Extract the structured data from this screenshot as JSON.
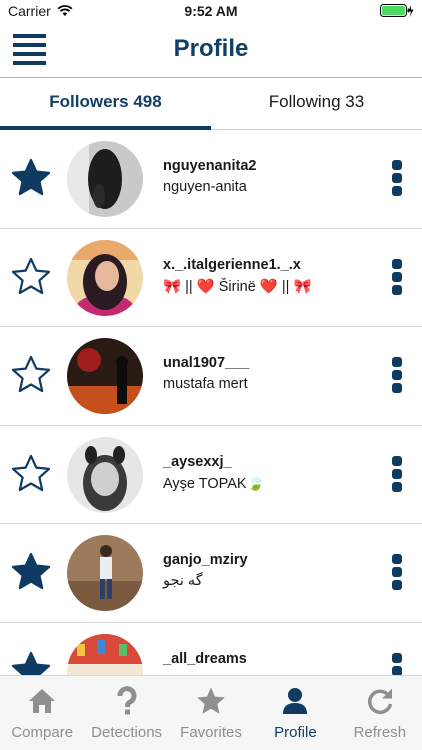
{
  "status_bar": {
    "carrier": "Carrier",
    "time": "9:52 AM"
  },
  "header": {
    "title": "Profile"
  },
  "tabs": [
    {
      "label": "Followers 498",
      "active": true
    },
    {
      "label": "Following 33",
      "active": false
    }
  ],
  "followers": [
    {
      "username": "nguyenanita2",
      "fullname": "nguyen-anita",
      "favorite": true
    },
    {
      "username": "x._.italgerienne1._.x",
      "fullname": "🎀 || ❤️ Širinë ❤️ || 🎀",
      "favorite": false
    },
    {
      "username": "unal1907___",
      "fullname": "mustafa mert",
      "favorite": false
    },
    {
      "username": "_aysexxj_",
      "fullname": "Ayşe TOPAK🍃",
      "favorite": false
    },
    {
      "username": "ganjo_mziry",
      "fullname": "گه نجو",
      "favorite": true
    },
    {
      "username": "_all_dreams",
      "fullname": "",
      "favorite": true
    }
  ],
  "bottom_nav": [
    {
      "label": "Compare",
      "icon": "home-icon",
      "active": false
    },
    {
      "label": "Detections",
      "icon": "question-icon",
      "active": false
    },
    {
      "label": "Favorites",
      "icon": "star-icon",
      "active": false
    },
    {
      "label": "Profile",
      "icon": "person-icon",
      "active": true
    },
    {
      "label": "Refresh",
      "icon": "refresh-icon",
      "active": false
    }
  ],
  "colors": {
    "accent": "#0f3b63",
    "inactive": "#8f8f8f"
  }
}
